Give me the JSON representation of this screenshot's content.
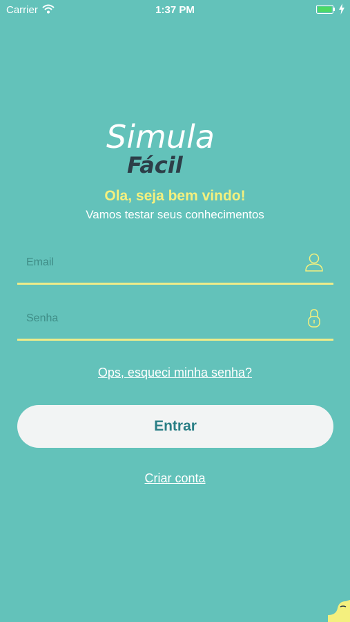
{
  "status_bar": {
    "carrier": "Carrier",
    "time": "1:37 PM",
    "icons": [
      "wifi-icon",
      "battery-icon",
      "charging-bolt-icon"
    ]
  },
  "logo": {
    "text_top": "Simula",
    "text_bottom": "Fácil"
  },
  "welcome": {
    "title": "Ola, seja bem vindo!",
    "subtitle": "Vamos testar seus conhecimentos"
  },
  "form": {
    "email_placeholder": "Email",
    "email_value": "",
    "email_icon": "user-icon",
    "password_placeholder": "Senha",
    "password_value": "",
    "password_icon": "lock-icon"
  },
  "links": {
    "forgot_password": "Ops, esqueci minha senha?",
    "create_account": "Criar conta"
  },
  "buttons": {
    "login": "Entrar"
  },
  "colors": {
    "background": "#63c2ba",
    "accent_yellow": "#f4f07e",
    "button_bg": "#f2f4f4",
    "button_text": "#2a7f86",
    "logo_dark": "#2d3e48"
  }
}
